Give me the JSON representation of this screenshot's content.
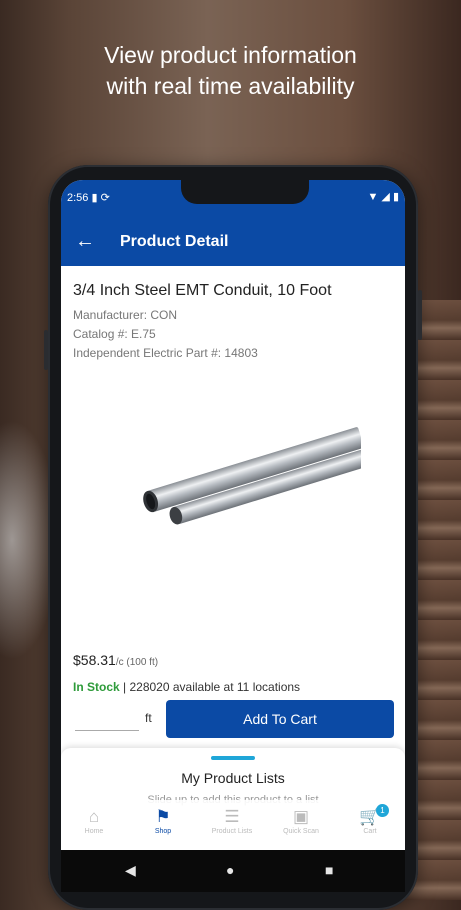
{
  "promo": {
    "line1": "View product information",
    "line2": "with real time availability"
  },
  "status_bar": {
    "time": "2:56"
  },
  "appbar": {
    "title": "Product Detail"
  },
  "product": {
    "name": "3/4 Inch Steel EMT Conduit, 10 Foot",
    "manufacturer": "Manufacturer: CON",
    "catalog": "Catalog #: E.75",
    "part": "Independent Electric Part #: 14803",
    "price": "$58.31",
    "price_unit": "/c (100 ft)",
    "stock_status": "In Stock",
    "availability": "| 228020 available at 11 locations"
  },
  "purchase": {
    "quantity_value": "",
    "unit_label": "ft",
    "add_to_cart_label": "Add To Cart"
  },
  "sheet": {
    "title": "My Product Lists",
    "hint": "Slide up to add this product to a list"
  },
  "bottom_nav": {
    "items": [
      {
        "label": "Home",
        "icon": "home-icon"
      },
      {
        "label": "Shop",
        "icon": "tag-icon"
      },
      {
        "label": "Product Lists",
        "icon": "list-icon"
      },
      {
        "label": "Quick Scan",
        "icon": "scan-icon"
      },
      {
        "label": "Cart",
        "icon": "cart-icon"
      }
    ],
    "cart_count": "1",
    "active_color": "#0b4aa5"
  },
  "colors": {
    "brand": "#0b4aa5",
    "in_stock": "#2e9b3a",
    "accent": "#1fa6d8"
  }
}
